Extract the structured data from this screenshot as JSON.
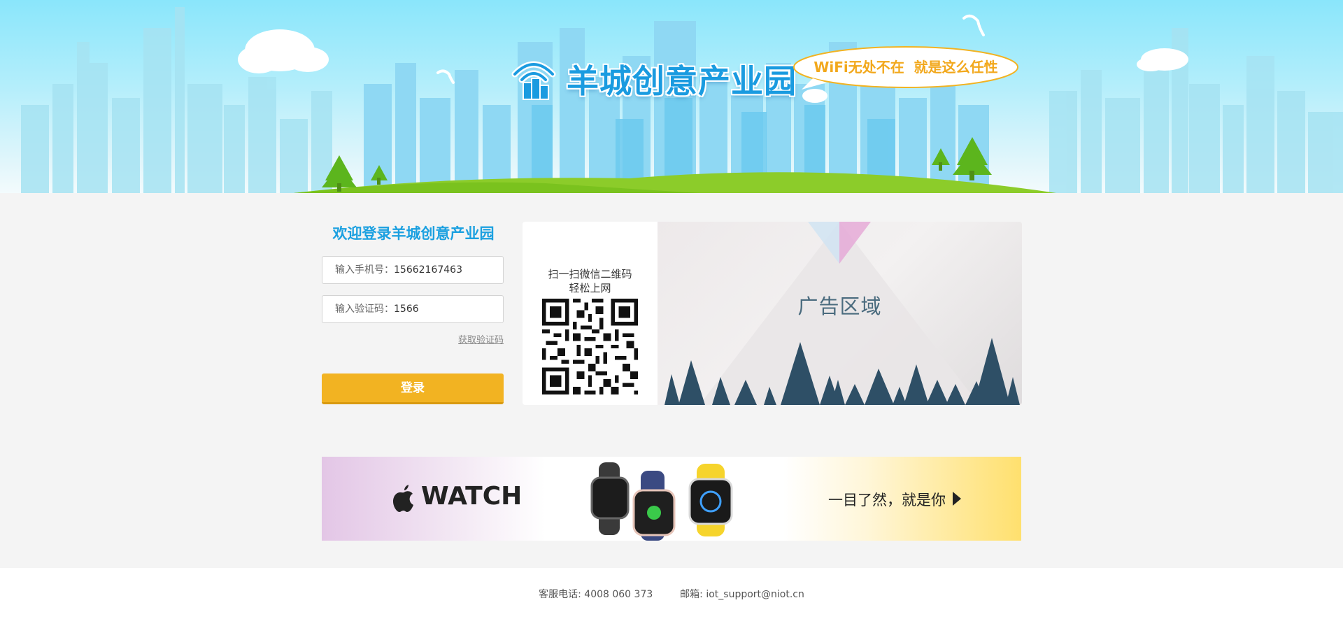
{
  "banner": {
    "brand_title": "羊城创意产业园",
    "slogan": "WiFi无处不在  就是这么任性"
  },
  "login": {
    "title": "欢迎登录羊城创意产业园",
    "phone_label": "输入手机号：",
    "phone_value": "15662167463",
    "code_label": "输入验证码：",
    "code_value": "1566",
    "get_code_link": "获取验证码",
    "submit_label": "登录"
  },
  "qr": {
    "line1": "扫一扫微信二维码",
    "line2": "轻松上网"
  },
  "ad": {
    "label": "广告区域"
  },
  "watch_ad": {
    "brand_word": "WATCH",
    "slogan": "一目了然，就是你"
  },
  "footer": {
    "phone_key": "客服电话:",
    "phone_value": "4008 060 373",
    "email_key": "邮箱:",
    "email_value": "iot_support@niot.cn"
  },
  "colors": {
    "accent_blue": "#1ba0e0",
    "button_yellow": "#f2b322",
    "slogan_orange": "#f2a81c"
  }
}
